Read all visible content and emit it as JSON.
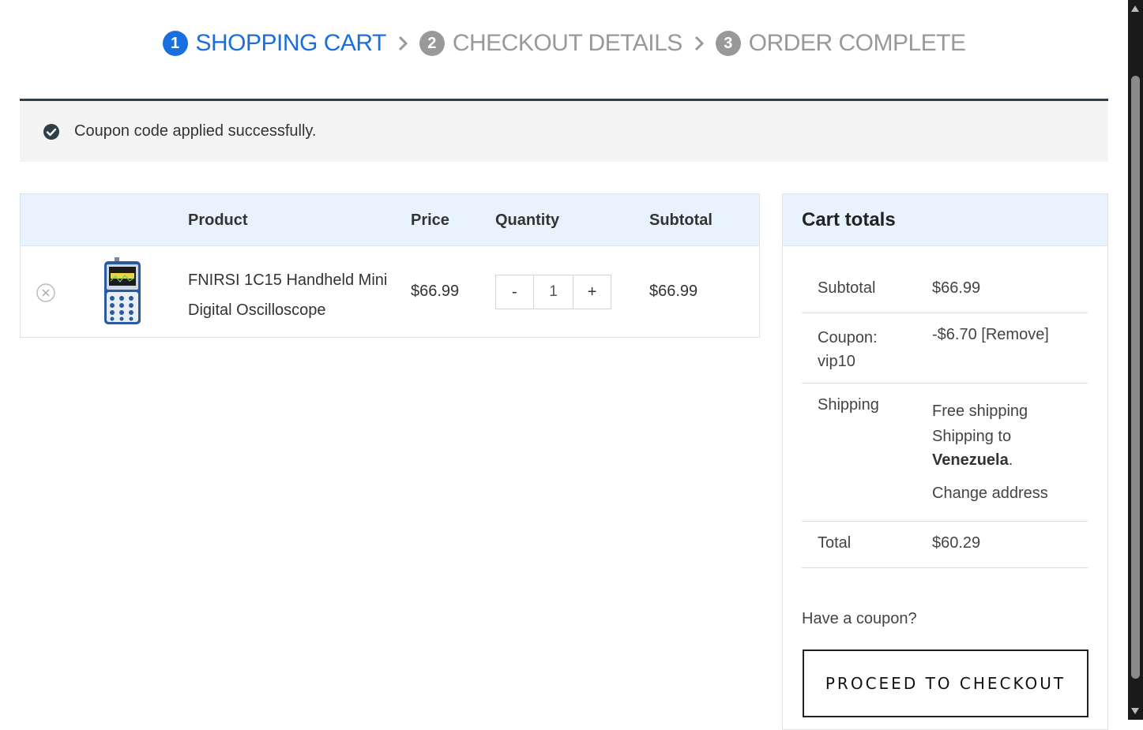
{
  "steps": [
    {
      "num": "1",
      "label": "SHOPPING CART"
    },
    {
      "num": "2",
      "label": "CHECKOUT DETAILS"
    },
    {
      "num": "3",
      "label": "ORDER COMPLETE"
    }
  ],
  "notice": {
    "text": "Coupon code applied successfully."
  },
  "cart": {
    "headers": {
      "product": "Product",
      "price": "Price",
      "quantity": "Quantity",
      "subtotal": "Subtotal"
    },
    "item": {
      "name_line1": "FNIRSI 1C15 Handheld Mini",
      "name_line2": "Digital Oscilloscope",
      "price": "$66.99",
      "quantity": "1",
      "minus": "-",
      "plus": "+",
      "subtotal": "$66.99"
    }
  },
  "totals": {
    "title": "Cart totals",
    "subtotal_label": "Subtotal",
    "subtotal_value": "$66.99",
    "coupon_label_line1": "Coupon:",
    "coupon_label_line2": "vip10",
    "coupon_value": "-$6.70",
    "coupon_remove": "[Remove]",
    "shipping_label": "Shipping",
    "shipping_method": "Free shipping",
    "shipping_to_prefix": "Shipping to",
    "shipping_country": "Venezuela",
    "shipping_to_suffix": ".",
    "change_address": "Change address",
    "total_label": "Total",
    "total_value": "$60.29",
    "coupon_question": "Have a coupon?",
    "checkout_button": "PROCEED TO CHECKOUT"
  },
  "colors": {
    "accent": "#1a6fe0",
    "header_bg": "#e8f3fd",
    "notice_border": "#2f3e48"
  }
}
